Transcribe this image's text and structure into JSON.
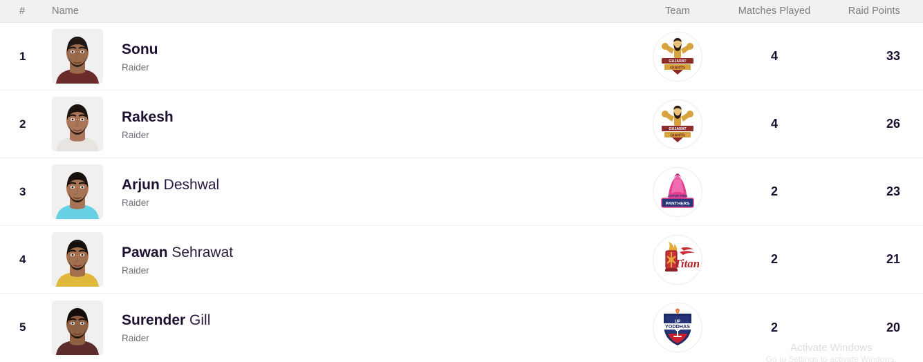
{
  "table": {
    "columns": {
      "rank": "#",
      "name": "Name",
      "team": "Team",
      "matches_played": "Matches Played",
      "raid_points": "Raid Points"
    },
    "rows": [
      {
        "rank": "1",
        "first_name": "Sonu",
        "last_name": "",
        "role": "Raider",
        "team": "Gujarat Giants",
        "team_logo": "gujarat-giants-logo",
        "matches_played": "4",
        "raid_points": "33",
        "avatar": "player-photo-sonu",
        "skin": "#9a6a4c",
        "hair": "#221712",
        "shirt": "#6b2c2c"
      },
      {
        "rank": "2",
        "first_name": "Rakesh",
        "last_name": "",
        "role": "Raider",
        "team": "Gujarat Giants",
        "team_logo": "gujarat-giants-logo",
        "matches_played": "4",
        "raid_points": "26",
        "avatar": "player-photo-rakesh",
        "skin": "#a9765a",
        "hair": "#1c130f",
        "shirt": "#e8e4e0"
      },
      {
        "rank": "3",
        "first_name": "Arjun",
        "last_name": "Deshwal",
        "role": "Raider",
        "team": "Jaipur Pink Panthers",
        "team_logo": "jaipur-pink-panthers-logo",
        "matches_played": "2",
        "raid_points": "23",
        "avatar": "player-photo-arjun-deshwal",
        "skin": "#a87355",
        "hair": "#17100d",
        "shirt": "#67d2e6"
      },
      {
        "rank": "4",
        "first_name": "Pawan",
        "last_name": "Sehrawat",
        "role": "Raider",
        "team": "Telugu Titans",
        "team_logo": "telugu-titans-logo",
        "matches_played": "2",
        "raid_points": "21",
        "avatar": "player-photo-pawan-sehrawat",
        "skin": "#a3704f",
        "hair": "#160f0b",
        "shirt": "#e0b93c"
      },
      {
        "rank": "5",
        "first_name": "Surender",
        "last_name": "Gill",
        "role": "Raider",
        "team": "UP Yoddhas",
        "team_logo": "up-yoddhas-logo",
        "matches_played": "2",
        "raid_points": "20",
        "avatar": "player-photo-surender-gill",
        "skin": "#8e5f42",
        "hair": "#140d09",
        "shirt": "#5d2b2b"
      }
    ]
  },
  "watermark": {
    "title": "Activate Windows",
    "subtitle": "Go to Settings to activate Windows."
  },
  "colors": {
    "header_bg": "#f1f1f1",
    "header_text": "#7b7b82",
    "row_border": "#eeeeee",
    "name_text": "#1d1030",
    "role_text": "#6e6e76",
    "avatar_bg": "#f0f0f0",
    "logo_border": "#ededed"
  }
}
